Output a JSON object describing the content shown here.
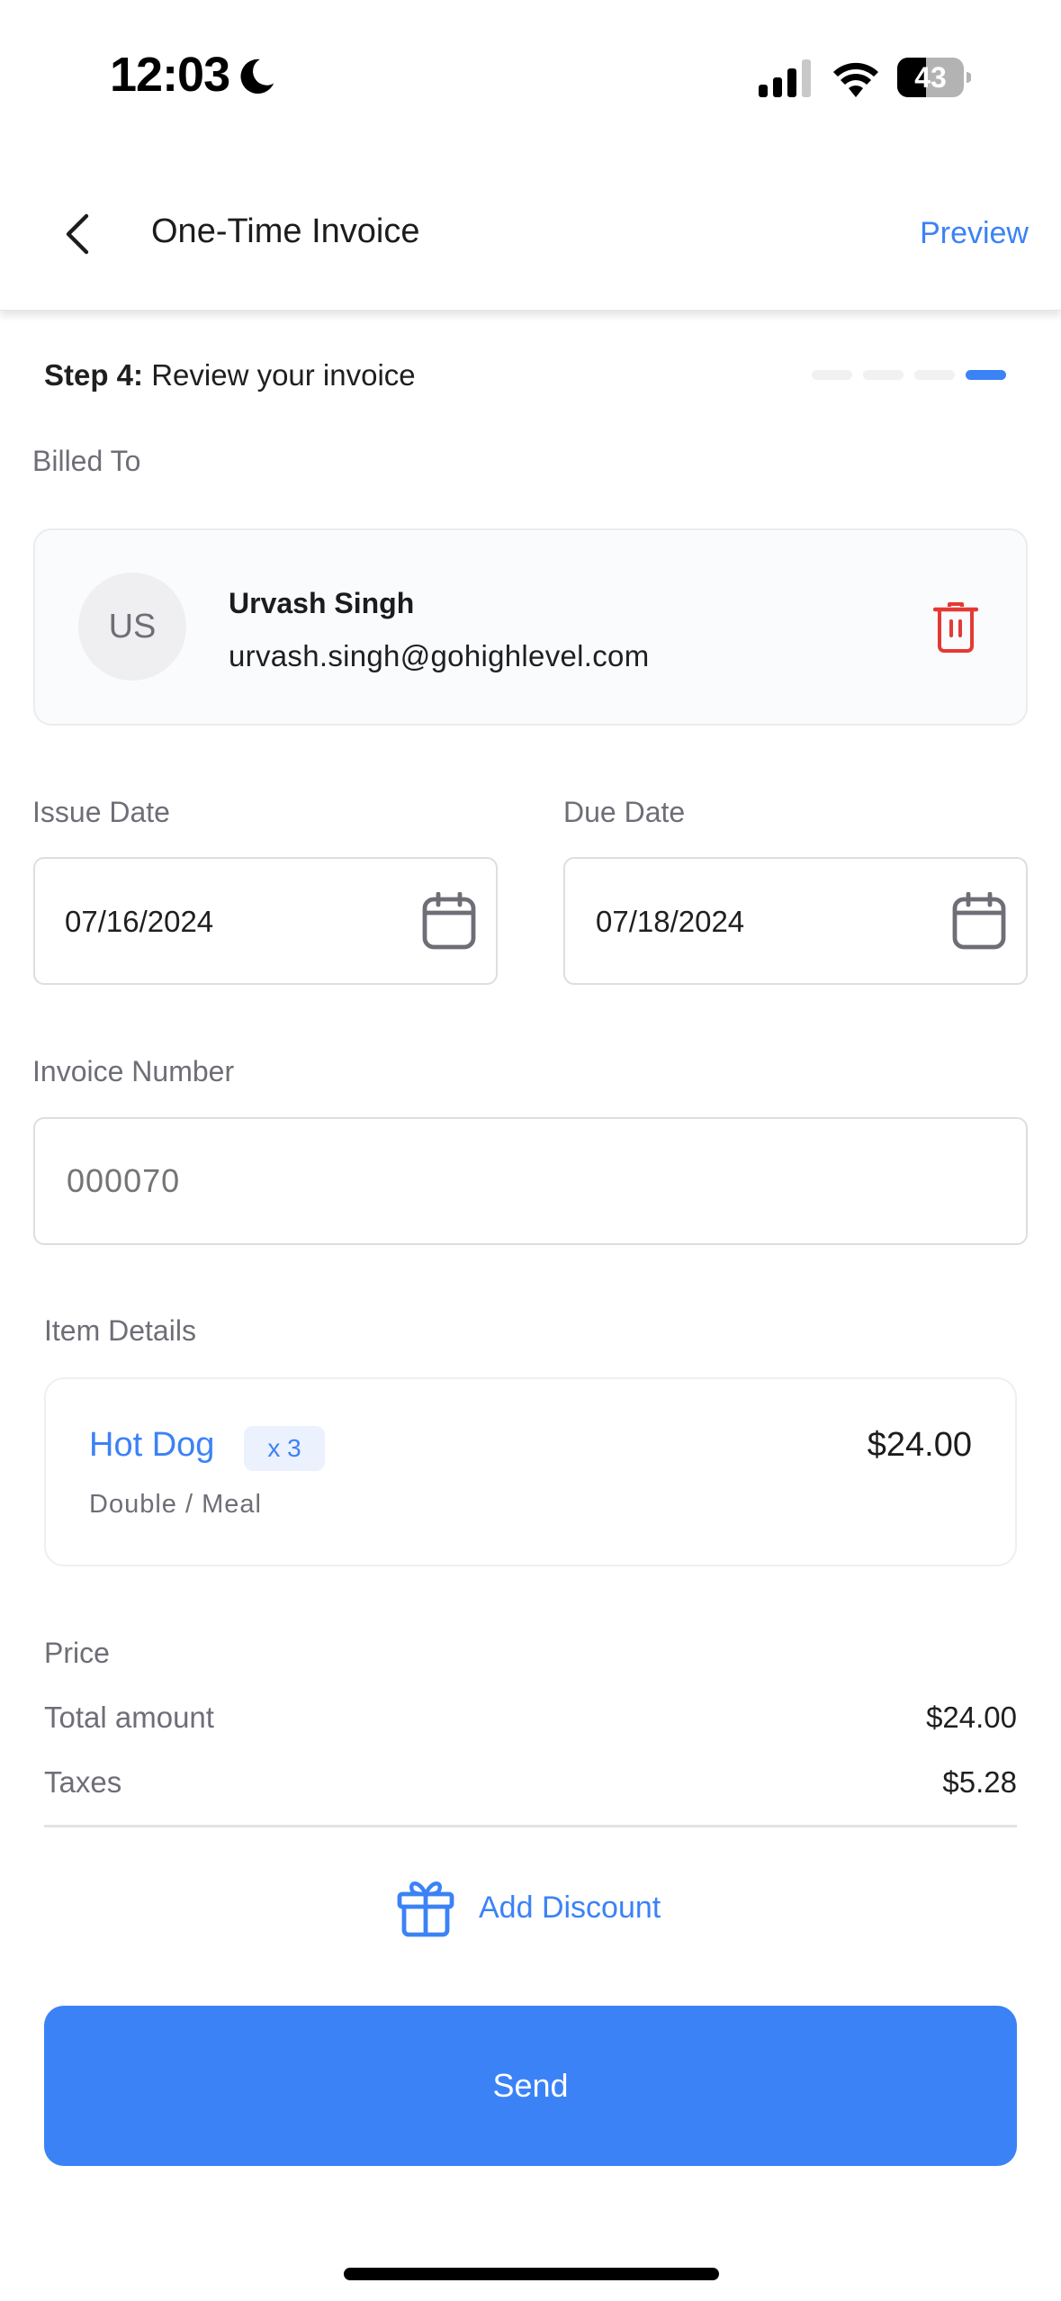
{
  "status_bar": {
    "time": "12:03",
    "battery_level": "43",
    "icons": [
      "moon-icon",
      "cellular-signal-icon",
      "wifi-icon",
      "battery-icon"
    ]
  },
  "header": {
    "back_icon": "chevron-left-icon",
    "title": "One-Time Invoice",
    "preview_label": "Preview"
  },
  "step": {
    "prefix": "Step 4:",
    "text": " Review your invoice",
    "current": 4,
    "total": 4
  },
  "billed_to": {
    "label": "Billed To",
    "initials": "US",
    "name": "Urvash Singh",
    "email": "urvash.singh@gohighlevel.com",
    "delete_icon": "trash-icon"
  },
  "dates": {
    "issue_label": "Issue Date",
    "issue_value": "07/16/2024",
    "due_label": "Due Date",
    "due_value": "07/18/2024",
    "icon": "calendar-icon"
  },
  "invoice_number": {
    "label": "Invoice Number",
    "placeholder": "000070"
  },
  "items": {
    "label": "Item Details",
    "list": [
      {
        "name": "Hot Dog",
        "quantity": "x 3",
        "price": "$24.00",
        "variant": "Double / Meal"
      }
    ]
  },
  "price": {
    "label": "Price",
    "rows": [
      {
        "label": "Total amount",
        "value": "$24.00"
      },
      {
        "label": "Taxes",
        "value": "$5.28"
      }
    ]
  },
  "discount": {
    "icon": "gift-icon",
    "label": "Add Discount"
  },
  "actions": {
    "send_label": "Send"
  },
  "colors": {
    "accent": "#3b82f6",
    "danger": "#e53935",
    "muted_text": "#6e6e77"
  }
}
